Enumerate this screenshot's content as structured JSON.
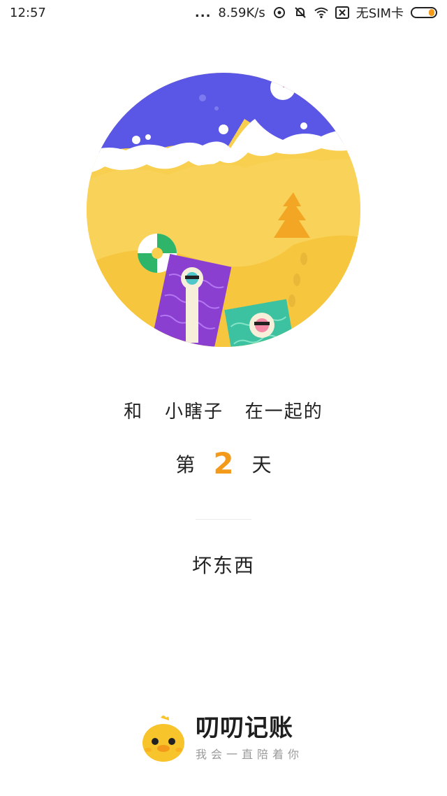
{
  "status_bar": {
    "time": "12:57",
    "dots": "...",
    "speed": "8.59K/s",
    "sim": "无SIM卡",
    "icons": [
      "location-icon",
      "mute-bell-icon",
      "wifi-icon",
      "sim-off-icon",
      "battery-icon"
    ]
  },
  "illustration": {
    "name": "beach-scene",
    "colors": {
      "sky": "#5b57e6",
      "sand": "#f8cf4e",
      "sand_shadow": "#f2bc2f",
      "towel_purple": "#8b3fd1",
      "towel_green": "#3cc2a0"
    }
  },
  "message": {
    "prefix": "和",
    "partner_name": "小瞎子",
    "suffix": "在一起的",
    "day_prefix": "第",
    "day_count": "2",
    "day_suffix": "天"
  },
  "nickname": "坏东西",
  "brand": {
    "name": "叨叨记账",
    "slogan": "我会一直陪着你",
    "accent_color": "#f39a1a"
  }
}
